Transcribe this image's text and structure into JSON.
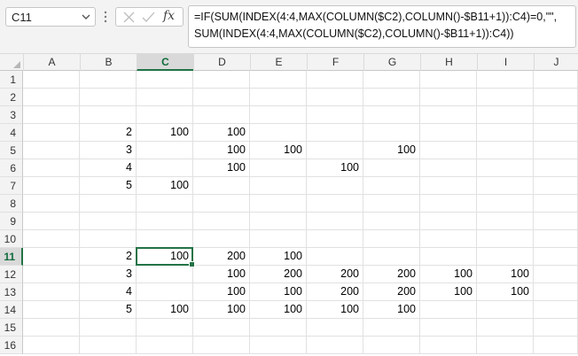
{
  "name_box": {
    "value": "C11"
  },
  "formula": {
    "line1": "=IF(SUM(INDEX(4:4,MAX(COLUMN($C2),COLUMN()-$B11+1)):C4)=0,\"\",",
    "line2": "SUM(INDEX(4:4,MAX(COLUMN($C2),COLUMN()-$B11+1)):C4))"
  },
  "icons": {
    "cancel": "close-icon",
    "enter": "check-icon",
    "function": "fx-icon",
    "fx_label": "fx"
  },
  "colors": {
    "accent": "#217346",
    "header_bg": "#f3f3f3",
    "gridline": "#e1e1e1"
  },
  "columns": [
    "A",
    "B",
    "C",
    "D",
    "E",
    "F",
    "G",
    "H",
    "I",
    "J"
  ],
  "selected_column": "C",
  "selected_row": 11,
  "rows": [
    {
      "num": "1",
      "cells": [
        "",
        "",
        "",
        "",
        "",
        "",
        "",
        "",
        "",
        ""
      ]
    },
    {
      "num": "2",
      "cells": [
        "",
        "",
        "",
        "",
        "",
        "",
        "",
        "",
        "",
        ""
      ]
    },
    {
      "num": "3",
      "cells": [
        "",
        "",
        "",
        "",
        "",
        "",
        "",
        "",
        "",
        ""
      ]
    },
    {
      "num": "4",
      "cells": [
        "",
        "2",
        "100",
        "100",
        "",
        "",
        "",
        "",
        "",
        ""
      ]
    },
    {
      "num": "5",
      "cells": [
        "",
        "3",
        "",
        "100",
        "100",
        "",
        "100",
        "",
        "",
        ""
      ]
    },
    {
      "num": "6",
      "cells": [
        "",
        "4",
        "",
        "100",
        "",
        "100",
        "",
        "",
        "",
        ""
      ]
    },
    {
      "num": "7",
      "cells": [
        "",
        "5",
        "100",
        "",
        "",
        "",
        "",
        "",
        "",
        ""
      ]
    },
    {
      "num": "8",
      "cells": [
        "",
        "",
        "",
        "",
        "",
        "",
        "",
        "",
        "",
        ""
      ]
    },
    {
      "num": "9",
      "cells": [
        "",
        "",
        "",
        "",
        "",
        "",
        "",
        "",
        "",
        ""
      ]
    },
    {
      "num": "10",
      "cells": [
        "",
        "",
        "",
        "",
        "",
        "",
        "",
        "",
        "",
        ""
      ]
    },
    {
      "num": "11",
      "cells": [
        "",
        "2",
        "100",
        "200",
        "100",
        "",
        "",
        "",
        "",
        ""
      ]
    },
    {
      "num": "12",
      "cells": [
        "",
        "3",
        "",
        "100",
        "200",
        "200",
        "200",
        "100",
        "100",
        ""
      ]
    },
    {
      "num": "13",
      "cells": [
        "",
        "4",
        "",
        "100",
        "100",
        "200",
        "200",
        "100",
        "100",
        ""
      ]
    },
    {
      "num": "14",
      "cells": [
        "",
        "5",
        "100",
        "100",
        "100",
        "100",
        "100",
        "",
        "",
        ""
      ]
    },
    {
      "num": "15",
      "cells": [
        "",
        "",
        "",
        "",
        "",
        "",
        "",
        "",
        "",
        ""
      ]
    },
    {
      "num": "16",
      "cells": [
        "",
        "",
        "",
        "",
        "",
        "",
        "",
        "",
        "",
        ""
      ]
    }
  ]
}
